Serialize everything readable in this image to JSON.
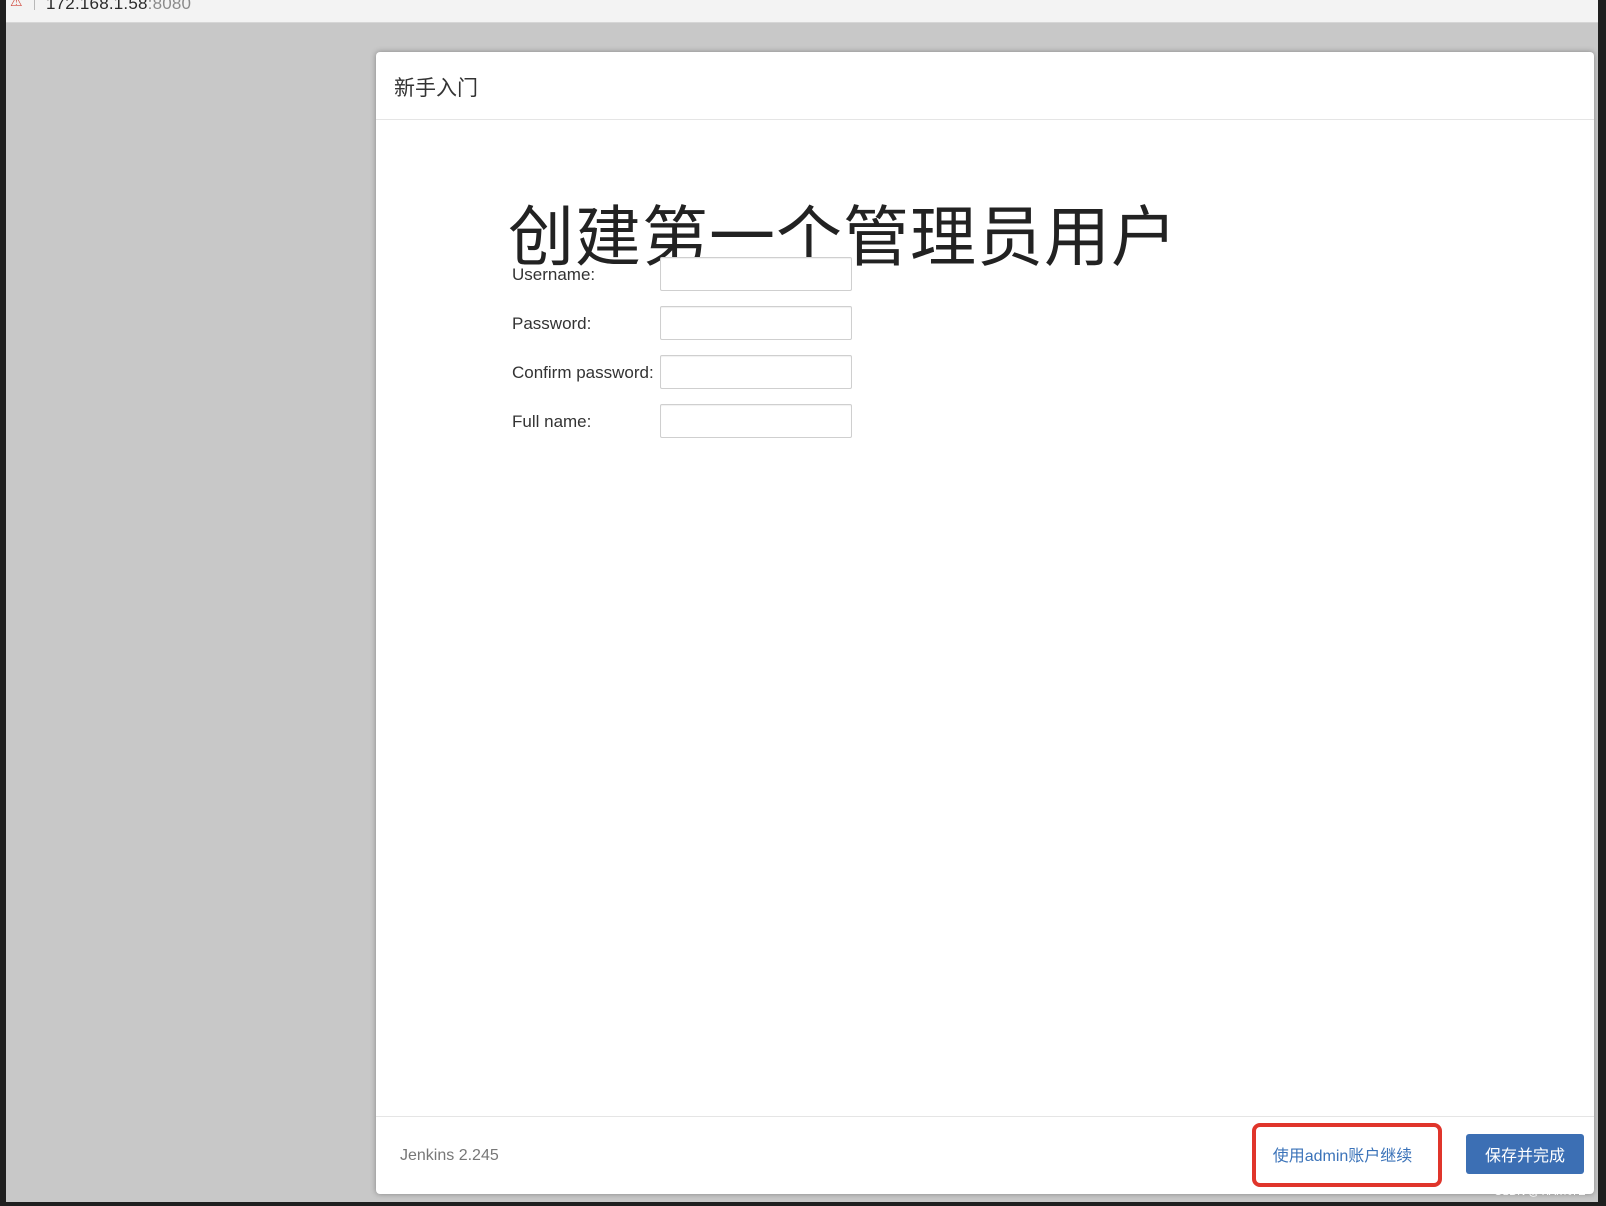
{
  "browser": {
    "security_icon": "不安全",
    "address_host": "172.168.1.58",
    "address_port": ":8080"
  },
  "dialog": {
    "title": "新手入门",
    "heading": "创建第一个管理员用户",
    "fields": [
      {
        "label": "Username:",
        "value": ""
      },
      {
        "label": "Password:",
        "value": ""
      },
      {
        "label": "Confirm password:",
        "value": ""
      },
      {
        "label": "Full name:",
        "value": ""
      }
    ],
    "footer": {
      "version": "Jenkins 2.245",
      "continue_as_admin": "使用admin账户继续",
      "save_finish": "保存并完成"
    }
  },
  "watermark": "CSDN @YiAn%7E",
  "colors": {
    "primary_button": "#3c6fb4",
    "link": "#3b73b9",
    "highlight": "#e0352b"
  }
}
